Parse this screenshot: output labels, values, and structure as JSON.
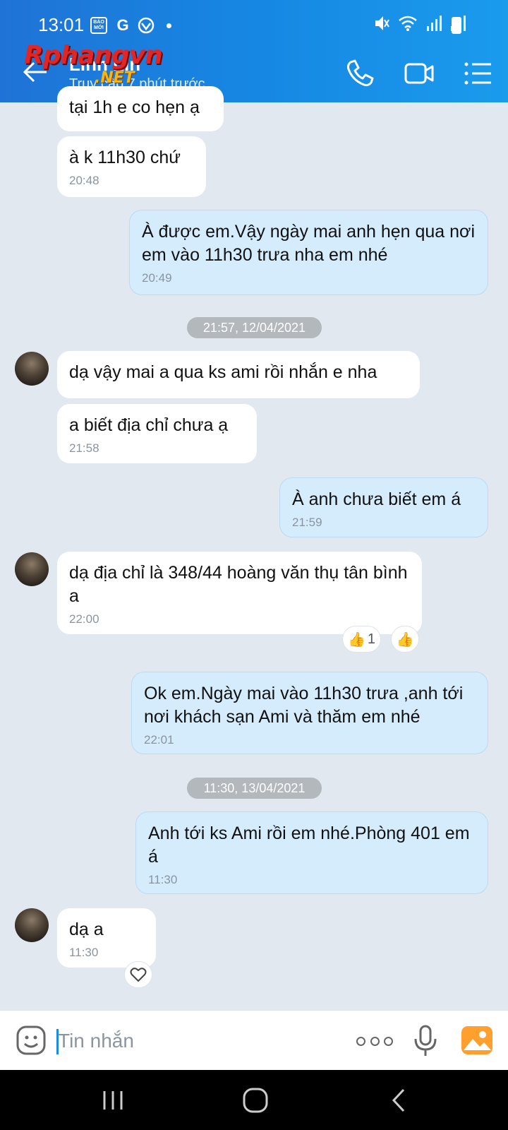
{
  "status": {
    "time": "13:01",
    "bao_moi": "BÁO MỚI",
    "g_icon": "G"
  },
  "header": {
    "contact_name": "Linh Lin",
    "last_seen": "Truy cập 7 phút trước",
    "watermark_brand": "Rphangvn",
    "watermark_tld": ".NET"
  },
  "messages": [
    {
      "dir": "in",
      "text": "tại 1h e co hẹn ạ",
      "time": ""
    },
    {
      "dir": "in",
      "text": "à k 11h30 chứ",
      "time": "20:48"
    },
    {
      "dir": "out",
      "text": "À được em.Vậy ngày mai anh hẹn qua nơi em vào 11h30 trưa nha em nhé",
      "time": "20:49"
    },
    {
      "dir": "divider",
      "text": "21:57, 12/04/2021"
    },
    {
      "dir": "in",
      "text": "dạ vậy mai a qua ks ami rồi nhắn e nha",
      "time": ""
    },
    {
      "dir": "in",
      "text": "a biết địa chỉ chưa ạ",
      "time": "21:58"
    },
    {
      "dir": "out",
      "text": "À anh chưa biết em á",
      "time": "21:59"
    },
    {
      "dir": "in",
      "text": "dạ địa chỉ là 348/44 hoàng văn thụ tân bình a",
      "time": "22:00",
      "reaction_count": "1"
    },
    {
      "dir": "out",
      "text": "Ok em.Ngày mai vào 11h30 trưa ,anh tới nơi khách sạn Ami và thăm em nhé",
      "time": "22:01"
    },
    {
      "dir": "divider",
      "text": "11:30, 13/04/2021"
    },
    {
      "dir": "out",
      "text": "Anh tới ks Ami rồi em nhé.Phòng 401 em á",
      "time": "11:30"
    },
    {
      "dir": "in",
      "text": "dạ a",
      "time": "11:30"
    }
  ],
  "composer": {
    "placeholder": "Tin nhắn"
  },
  "icons": [
    "back-arrow-icon",
    "phone-icon",
    "video-call-icon",
    "menu-list-icon",
    "emoji-icon",
    "more-dots-icon",
    "microphone-icon",
    "photo-icon",
    "thumbs-up-icon",
    "heart-icon"
  ],
  "colors": {
    "header_start": "#1f73d6",
    "header_end": "#1a9bec",
    "bubble_in": "#ffffff",
    "bubble_out": "#d5ecfd",
    "chat_bg": "#e2e8ef"
  }
}
